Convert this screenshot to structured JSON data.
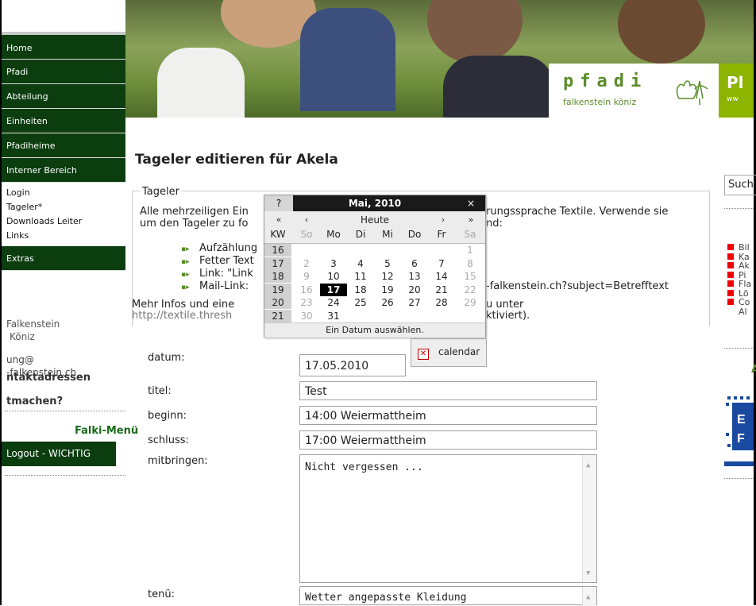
{
  "nav": {
    "main": [
      "Home",
      "Pfadi",
      "Abteilung",
      "Einheiten",
      "Pfadiheime",
      "Interner Bereich"
    ],
    "sub": [
      "Login",
      "Tageler*",
      "Downloads Leiter",
      "Links"
    ],
    "extras": "Extras",
    "address_lines": [
      "Falkenstein",
      "Köniz"
    ],
    "email_lines": [
      "ung@",
      "-falkenstein.ch"
    ],
    "kontakt": "ntaktadressen",
    "mitmachen": "tmachen?",
    "falki_menu": "Falki-Menü",
    "logout": "Logout - WICHTIG"
  },
  "header": {
    "logo_word": "pfadi",
    "logo_sub": "falkenstein köniz",
    "logo2_letter": "Pl",
    "logo2_sub": "ww"
  },
  "page": {
    "title": "Tageler editieren für Akela",
    "legend": "Tageler",
    "intro1_left": "Alle mehrzeiligen Ein",
    "intro1_right": "rungssprache Textile. Verwende sie",
    "intro2_left": "um den Tageler zu fo",
    "intro2_right": "nd:",
    "list": [
      "Aufzählung",
      "Fetter Text",
      "Link: \"Link",
      "Mail-Link:"
    ],
    "mail_tail": "-falkenstein.ch?subject=Betrefftext",
    "more1_left": "Mehr Infos und eine",
    "more1_right": "u unter",
    "more2_left": "http://textile.thresh",
    "more2_right": "ktiviert)."
  },
  "form": {
    "datum_label": "datum:",
    "datum_value": "17.05.2010",
    "calendar_button": "calendar",
    "titel_label": "titel:",
    "titel_value": "Test",
    "beginn_label": "beginn:",
    "beginn_value": "14:00 Weiermattheim",
    "schluss_label": "schluss:",
    "schluss_value": "17:00 Weiermattheim",
    "mitbringen_label": "mitbringen:",
    "mitbringen_value": "Nicht vergessen ...",
    "tenue_label": "tenü:",
    "tenue_value": "Wetter angepasste Kleidung"
  },
  "calendar": {
    "help": "?",
    "month": "Mai, 2010",
    "close": "×",
    "nav": [
      "«",
      "‹",
      "Heute",
      "›",
      "»"
    ],
    "dow": [
      "KW",
      "So",
      "Mo",
      "Di",
      "Mi",
      "Do",
      "Fr",
      "Sa"
    ],
    "weeks": [
      [
        "16",
        "",
        "",
        "",
        "",
        "",
        "",
        "1"
      ],
      [
        "17",
        "2",
        "3",
        "4",
        "5",
        "6",
        "7",
        "8"
      ],
      [
        "18",
        "9",
        "10",
        "11",
        "12",
        "13",
        "14",
        "15"
      ],
      [
        "19",
        "16",
        "17",
        "18",
        "19",
        "20",
        "21",
        "22"
      ],
      [
        "20",
        "23",
        "24",
        "25",
        "26",
        "27",
        "28",
        "29"
      ],
      [
        "21",
        "30",
        "31",
        "",
        "",
        "",
        "",
        ""
      ]
    ],
    "selected": "17",
    "footer": "Ein Datum auswählen."
  },
  "right": {
    "search_placeholder": "Such",
    "links": [
      "Bil",
      "Ka",
      "Ak",
      "Pi",
      "Fla",
      "Lö",
      "Co",
      "Al"
    ],
    "accent": "A"
  },
  "colors": {
    "nav_bg": "#0b3d0f",
    "brand_green": "#5a8c2a",
    "lime": "#8cb400"
  }
}
